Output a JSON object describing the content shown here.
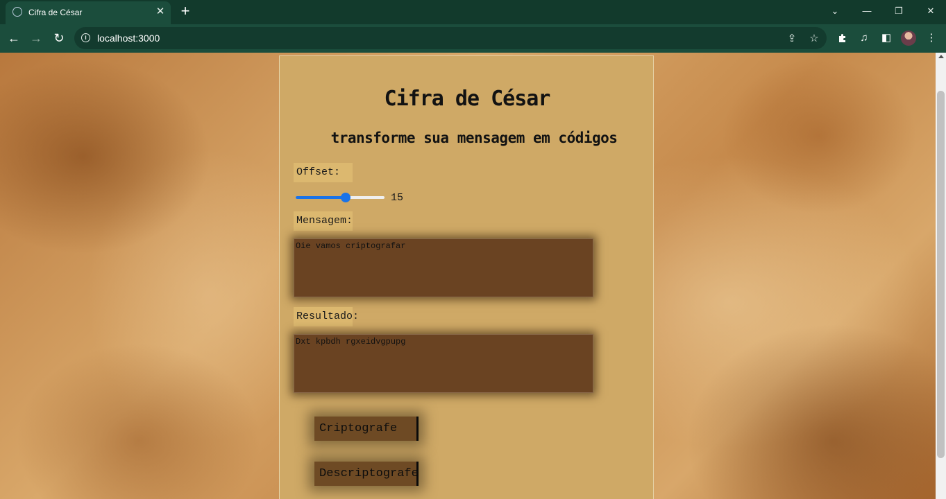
{
  "browser": {
    "tab_title": "Cifra de César",
    "url": "localhost:3000",
    "icons": {
      "favicon": "globe-icon",
      "close": "✕",
      "new_tab": "+",
      "back": "←",
      "forward": "→",
      "reload": "↻",
      "share": "⇪",
      "star": "☆",
      "extensions": "puzzle-icon",
      "media": "♫",
      "sidepanel": "◧",
      "menu": "⋮",
      "tab_search": "⌄",
      "minimize": "—",
      "restore": "❐",
      "window_close": "✕"
    }
  },
  "page": {
    "title": "Cifra de César",
    "subtitle": "transforme sua mensagem em códigos",
    "offset_label": "Offset:",
    "offset_value": "15",
    "offset_fraction": 0.56,
    "message_label": "Mensagem:",
    "message_value": "Oie vamos criptografar",
    "result_label": "Resultado:",
    "result_value": "Dxt kpbdh rgxeidvgpupg",
    "encrypt_button": "Criptografe",
    "decrypt_button": "Descriptografe"
  }
}
